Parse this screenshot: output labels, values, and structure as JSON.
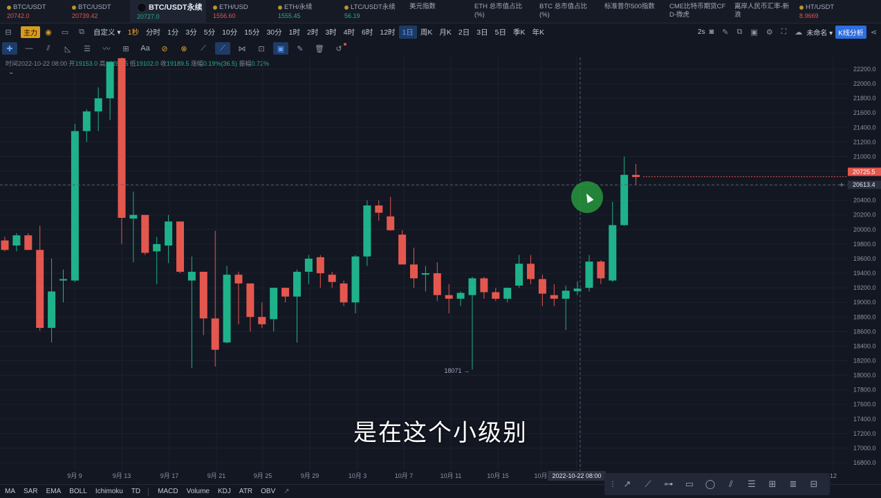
{
  "tickers": [
    {
      "name": "BTC/USDT",
      "price": "20742.0",
      "price_color": "#e4574f",
      "has_dot": true
    },
    {
      "name": "BTC/USDT",
      "price": "20739.42",
      "price_color": "#e4574f",
      "has_dot": true
    },
    {
      "name": "BTC/USDT永续",
      "price": "20727.0",
      "price_color": "#1fb28a",
      "active": true
    },
    {
      "name": "ETH/USD",
      "price": "1556.60",
      "price_color": "#e4574f",
      "has_dot": true
    },
    {
      "name": "ETH/永续",
      "price": "1555.45",
      "price_color": "#1fb28a",
      "has_dot": true
    },
    {
      "name": "LTC/USDT永续",
      "price": "56.19",
      "price_color": "#1fb28a",
      "has_dot": true
    },
    {
      "name": "美元指数",
      "price": ""
    },
    {
      "name": "ETH 总市值占比 (%)",
      "price": ""
    },
    {
      "name": "BTC 总市值占比 (%)",
      "price": ""
    },
    {
      "name": "标准普尔500指数",
      "price": ""
    },
    {
      "name": "CME比特币期货CF D-微虎",
      "price": ""
    },
    {
      "name": "离岸人民币汇率-新浪",
      "price": ""
    },
    {
      "name": "HT/USDT",
      "price": "8.9669",
      "price_color": "#e4574f",
      "has_dot": true
    }
  ],
  "toolbar": {
    "main_label": "主力",
    "custom_label": "自定义",
    "first_tf": "1秒",
    "timeframes": [
      "分时",
      "1分",
      "3分",
      "5分",
      "10分",
      "15分",
      "30分",
      "1时",
      "2时",
      "3时",
      "4时",
      "6时",
      "12时",
      "1日",
      "周K",
      "月K",
      "2日",
      "3日",
      "5日",
      "季K",
      "年K"
    ],
    "selected_tf": "1日",
    "right": {
      "interval": "2s",
      "layout_name": "未命名",
      "kline_button": "K线分析"
    }
  },
  "ohlc": {
    "time_label": "时间",
    "time": "2022-10-22 08:00",
    "open_label": "开",
    "open": "19153.0",
    "high_label": "高",
    "high": "19289.5",
    "low_label": "低",
    "low": "19102.0",
    "close_label": "收",
    "close": "19189.5",
    "change_label": "涨幅",
    "change": "0.19%(36.5)",
    "amplitude_label": "振幅",
    "amplitude": "0.72%"
  },
  "chart_data": {
    "type": "candlestick",
    "symbol": "BTC/USDT永续",
    "interval": "1日",
    "ylim": [
      16700,
      22300
    ],
    "y_ticks": [
      16800,
      17000,
      17200,
      17400,
      17600,
      17800,
      18000,
      18200,
      18400,
      18600,
      18800,
      19000,
      19200,
      19400,
      19600,
      19800,
      20000,
      20200,
      20400,
      20600,
      20800,
      21000,
      21200,
      21400,
      21600,
      21800,
      22000,
      22200
    ],
    "x_ticks": [
      "9月 9",
      "9月 13",
      "9月 17",
      "9月 21",
      "9月 25",
      "9月 29",
      "10月 3",
      "10月 7",
      "10月 11",
      "10月 15",
      "10月",
      "2022-10-22 08:00",
      "12"
    ],
    "candles": [
      {
        "o": 19850,
        "h": 19900,
        "l": 19700,
        "c": 19720
      },
      {
        "o": 19780,
        "h": 19950,
        "l": 19700,
        "c": 19920
      },
      {
        "o": 19920,
        "h": 19950,
        "l": 19720,
        "c": 19720
      },
      {
        "o": 19720,
        "h": 20050,
        "l": 18610,
        "c": 18650
      },
      {
        "o": 18650,
        "h": 19600,
        "l": 18450,
        "c": 19150
      },
      {
        "o": 19300,
        "h": 19450,
        "l": 19000,
        "c": 19320
      },
      {
        "o": 19300,
        "h": 21450,
        "l": 19280,
        "c": 21350
      },
      {
        "o": 21350,
        "h": 21650,
        "l": 21200,
        "c": 21620
      },
      {
        "o": 21620,
        "h": 21950,
        "l": 21350,
        "c": 21800
      },
      {
        "o": 21800,
        "h": 22300,
        "l": 21500,
        "c": 22300
      },
      {
        "o": 22350,
        "h": 22450,
        "l": 19800,
        "c": 20160
      },
      {
        "o": 20150,
        "h": 20520,
        "l": 19550,
        "c": 20200
      },
      {
        "o": 20200,
        "h": 20200,
        "l": 19650,
        "c": 19680
      },
      {
        "o": 19700,
        "h": 19900,
        "l": 19250,
        "c": 19800
      },
      {
        "o": 19780,
        "h": 20200,
        "l": 19540,
        "c": 20110
      },
      {
        "o": 20110,
        "h": 20110,
        "l": 19400,
        "c": 19420
      },
      {
        "o": 19300,
        "h": 19630,
        "l": 18100,
        "c": 19420
      },
      {
        "o": 19420,
        "h": 19420,
        "l": 18550,
        "c": 18780
      },
      {
        "o": 18780,
        "h": 19980,
        "l": 18120,
        "c": 18350
      },
      {
        "o": 18450,
        "h": 19500,
        "l": 18440,
        "c": 19380
      },
      {
        "o": 19380,
        "h": 19420,
        "l": 18700,
        "c": 19260
      },
      {
        "o": 19260,
        "h": 19260,
        "l": 18600,
        "c": 18800
      },
      {
        "o": 18800,
        "h": 19000,
        "l": 18650,
        "c": 18700
      },
      {
        "o": 18770,
        "h": 19200,
        "l": 18600,
        "c": 19200
      },
      {
        "o": 19200,
        "h": 19200,
        "l": 19000,
        "c": 19080
      },
      {
        "o": 19080,
        "h": 19450,
        "l": 18450,
        "c": 19420
      },
      {
        "o": 19420,
        "h": 19650,
        "l": 19250,
        "c": 19600
      },
      {
        "o": 19620,
        "h": 19650,
        "l": 19200,
        "c": 19400
      },
      {
        "o": 19380,
        "h": 19420,
        "l": 19200,
        "c": 19280
      },
      {
        "o": 19260,
        "h": 19300,
        "l": 18950,
        "c": 19000
      },
      {
        "o": 19000,
        "h": 19650,
        "l": 18850,
        "c": 19630
      },
      {
        "o": 19630,
        "h": 20400,
        "l": 19500,
        "c": 20330
      },
      {
        "o": 20330,
        "h": 20400,
        "l": 20120,
        "c": 20230
      },
      {
        "o": 20180,
        "h": 20450,
        "l": 19980,
        "c": 19990
      },
      {
        "o": 19930,
        "h": 19990,
        "l": 19550,
        "c": 19520
      },
      {
        "o": 19520,
        "h": 19750,
        "l": 19200,
        "c": 19330
      },
      {
        "o": 19380,
        "h": 19500,
        "l": 19150,
        "c": 19400
      },
      {
        "o": 19400,
        "h": 19550,
        "l": 19020,
        "c": 19100
      },
      {
        "o": 19100,
        "h": 19250,
        "l": 18850,
        "c": 19050
      },
      {
        "o": 19050,
        "h": 19150,
        "l": 18950,
        "c": 19130
      },
      {
        "o": 19100,
        "h": 19350,
        "l": 18080,
        "c": 19330
      },
      {
        "o": 19330,
        "h": 19350,
        "l": 19050,
        "c": 19140
      },
      {
        "o": 19140,
        "h": 19200,
        "l": 19020,
        "c": 19050
      },
      {
        "o": 19050,
        "h": 19200,
        "l": 19000,
        "c": 19200
      },
      {
        "o": 19230,
        "h": 19650,
        "l": 19200,
        "c": 19530
      },
      {
        "o": 19530,
        "h": 19650,
        "l": 19250,
        "c": 19320
      },
      {
        "o": 19320,
        "h": 19380,
        "l": 18950,
        "c": 19120
      },
      {
        "o": 19100,
        "h": 19250,
        "l": 18950,
        "c": 19050
      },
      {
        "o": 19050,
        "h": 19230,
        "l": 18620,
        "c": 19160
      },
      {
        "o": 19153,
        "h": 19289.5,
        "l": 19102,
        "c": 19189.5
      },
      {
        "o": 19200,
        "h": 19650,
        "l": 19150,
        "c": 19560
      },
      {
        "o": 19560,
        "h": 19580,
        "l": 19250,
        "c": 19330
      },
      {
        "o": 19300,
        "h": 20380,
        "l": 19280,
        "c": 20060
      },
      {
        "o": 20060,
        "h": 21000,
        "l": 20050,
        "c": 20750
      },
      {
        "o": 20750,
        "h": 20900,
        "l": 20610,
        "c": 20720
      }
    ],
    "current_price": "20725.5",
    "crosshair_price": "20613.4",
    "min_marker": "18071"
  },
  "indicators": [
    "MA",
    "SAR",
    "EMA",
    "BOLL",
    "Ichimoku",
    "TD",
    "MACD",
    "Volume",
    "KDJ",
    "ATR",
    "OBV"
  ],
  "subtitle": "是在这个小级别",
  "colors": {
    "up": "#1fb28a",
    "down": "#e4574f",
    "bg": "#131722",
    "accent": "#2d6ee0"
  }
}
